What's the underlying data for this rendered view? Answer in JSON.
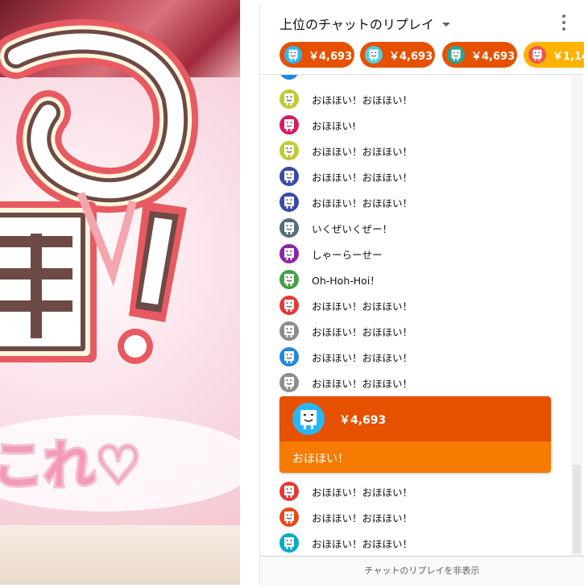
{
  "chat": {
    "title": "上位のチャットのリプレイ",
    "footer_label": "チャットのリプレイを非表示",
    "ticker": [
      {
        "amount": "￥4,693",
        "bg": "#e65100",
        "avatar_color": "#29b6f6"
      },
      {
        "amount": "￥4,693",
        "bg": "#e65100",
        "avatar_color": "#4dd0e1"
      },
      {
        "amount": "￥4,693",
        "bg": "#e65100",
        "avatar_color": "#26a69a"
      },
      {
        "amount": "￥1,14",
        "bg": "#ffb300",
        "avatar_color": "#ef5350"
      }
    ],
    "messages": [
      {
        "text": "おほほい！おほほい！",
        "avatar_color": "#c0ca33"
      },
      {
        "text": "おほほい!",
        "avatar_color": "#d81b60"
      },
      {
        "text": "おほほい！おほほい！",
        "avatar_color": "#c0ca33"
      },
      {
        "text": "おほほい！おほほい！",
        "avatar_color": "#3949ab"
      },
      {
        "text": "おほほい！おほほい！",
        "avatar_color": "#3949ab"
      },
      {
        "text": "いくぜいくぜー！",
        "avatar_color": "#546e7a"
      },
      {
        "text": "しゃーらーせー",
        "avatar_color": "#8e24aa"
      },
      {
        "text": "Oh-Hoh-Hoi！",
        "avatar_color": "#43a047"
      },
      {
        "text": "おほほい！おほほい！",
        "avatar_color": "#e53935"
      },
      {
        "text": "おほほい！おほほい！",
        "avatar_color": "#8d8d8d"
      },
      {
        "text": "おほほい！おほほい！",
        "avatar_color": "#1e88e5"
      },
      {
        "text": "おほほい！おほほい！",
        "avatar_color": "#8d8d8d"
      }
    ],
    "paid_message": {
      "amount": "￥4,693",
      "text": "おほほい！",
      "header_color": "#e65100",
      "body_color": "#f57c00",
      "avatar_color": "#29b6f6"
    },
    "messages_after": [
      {
        "text": "おほほい！おほほい！",
        "avatar_color": "#e53935"
      },
      {
        "text": "おほほい！おほほい！",
        "avatar_color": "#e64a19"
      },
      {
        "text": "おほほい！おほほい！",
        "avatar_color": "#00acc1"
      }
    ]
  },
  "video": {
    "heart_text": "これ♡"
  }
}
